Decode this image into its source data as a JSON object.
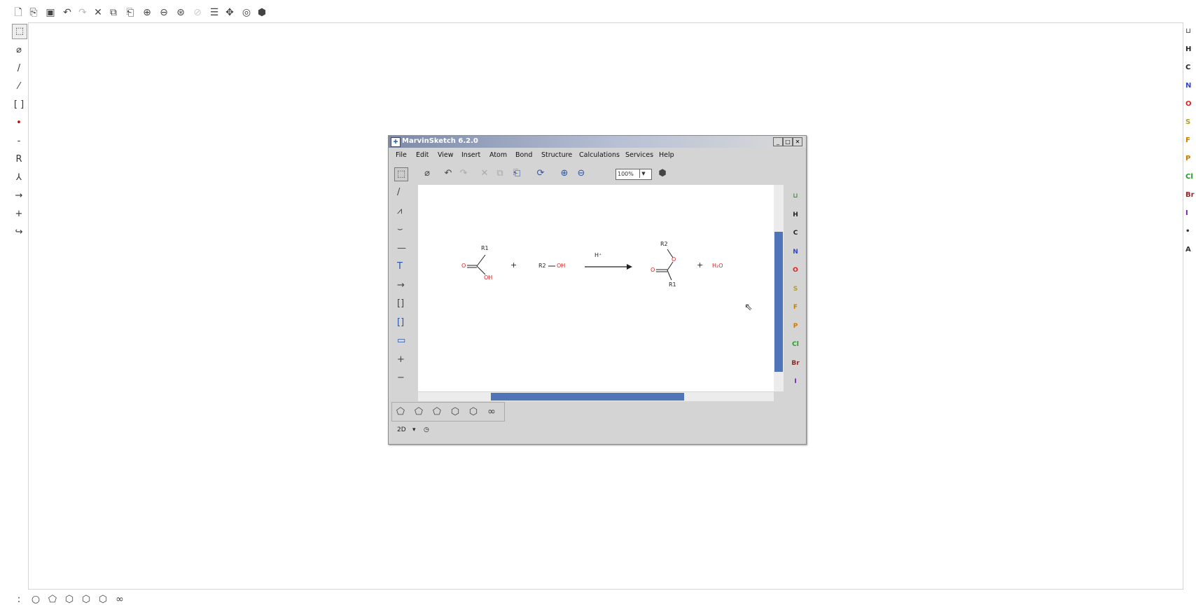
{
  "top_toolbar": {
    "icons": [
      "new-file-icon",
      "open-icon",
      "save-icon",
      "undo-icon",
      "redo-icon",
      "cut-icon",
      "copy-icon",
      "paste-icon",
      "zoom-in-icon",
      "zoom-out-icon",
      "zoom-fit-icon",
      "zoom-disabled-icon",
      "align-icon",
      "center-icon",
      "clean-icon",
      "help-icon"
    ]
  },
  "left_toolbar": {
    "icons": [
      "selection-tool-icon",
      "eraser-icon",
      "single-bond-icon",
      "chain-icon",
      "bracket-icon",
      "atom-dot-icon",
      "charge-icon",
      "r-group-icon",
      "reaction-arrow-icon",
      "arrow-icon",
      "plus-icon",
      "electron-flow-icon"
    ],
    "glyphs": [
      "⬚",
      "⌀",
      "/",
      "⁄",
      "[ ]",
      "•",
      "-",
      "R",
      "⅄",
      "→",
      "+",
      "↪"
    ]
  },
  "right_toolbar": {
    "elements": [
      {
        "label": "⊔",
        "color": "#666666"
      },
      {
        "label": "H",
        "color": "#222222"
      },
      {
        "label": "C",
        "color": "#222222"
      },
      {
        "label": "N",
        "color": "#3048c8"
      },
      {
        "label": "O",
        "color": "#e02020"
      },
      {
        "label": "S",
        "color": "#b0a020"
      },
      {
        "label": "F",
        "color": "#c88000"
      },
      {
        "label": "P",
        "color": "#d07800"
      },
      {
        "label": "Cl",
        "color": "#20a020"
      },
      {
        "label": "Br",
        "color": "#8a2a2a"
      },
      {
        "label": "I",
        "color": "#7020b0"
      },
      {
        "label": "•",
        "color": "#333333"
      },
      {
        "label": "A",
        "color": "#333333"
      }
    ]
  },
  "bottom_toolbar": {
    "icons": [
      "more-icon",
      "cyclopropane-icon",
      "cyclobutane-icon",
      "cyclopentane-icon",
      "benzene-icon",
      "cyclohexane-icon",
      "naphthalene-icon"
    ],
    "glyphs": [
      ":",
      "○",
      "⬠",
      "⬡",
      "⬡",
      "⬡",
      "∞"
    ]
  },
  "inner_window": {
    "title": "MarvinSketch 6.2.0",
    "menu": [
      "File",
      "Edit",
      "View",
      "Insert",
      "Atom",
      "Bond",
      "Structure",
      "Calculations",
      "Services",
      "Help"
    ],
    "zoom": "100%",
    "left_tools": [
      "/",
      "⩘",
      "⌣",
      "—",
      "T",
      "→",
      "[]",
      "[]",
      "▭",
      "+",
      "−"
    ],
    "right_elements": [
      {
        "label": "⊔",
        "color": "#3a8a3a"
      },
      {
        "label": "H",
        "color": "#222222"
      },
      {
        "label": "C",
        "color": "#222222"
      },
      {
        "label": "N",
        "color": "#3048c8"
      },
      {
        "label": "O",
        "color": "#e02020"
      },
      {
        "label": "S",
        "color": "#b0a020"
      },
      {
        "label": "F",
        "color": "#c88000"
      },
      {
        "label": "P",
        "color": "#d07800"
      },
      {
        "label": "Cl",
        "color": "#20a020"
      },
      {
        "label": "Br",
        "color": "#8a2a2a"
      },
      {
        "label": "I",
        "color": "#7020b0"
      }
    ],
    "status_mode": "2D",
    "reaction": {
      "r1": "R1",
      "o": "O",
      "oh": "OH",
      "plus": "+",
      "r2oh_r": "R2",
      "r2oh_oh": "OH",
      "catalyst": "H⁺",
      "r2": "R2",
      "o2": "O",
      "o3": "O",
      "r1b": "R1",
      "h2o": "H₂O"
    }
  }
}
